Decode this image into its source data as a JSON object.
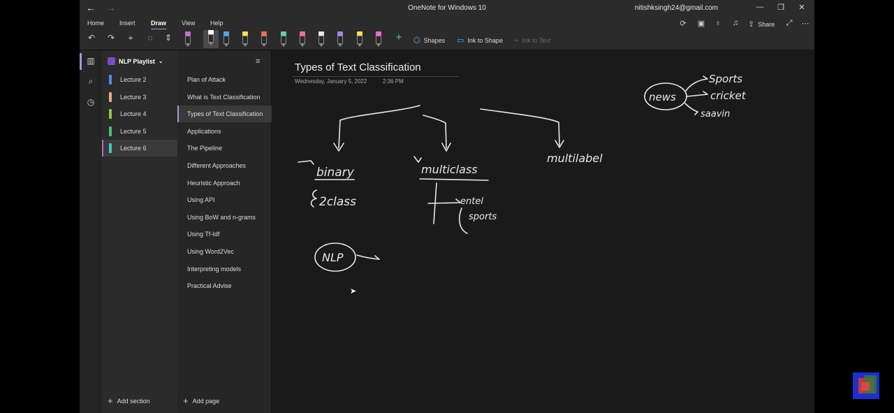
{
  "window": {
    "title": "OneNote for Windows 10",
    "account": "nitishksingh24@gmail.com",
    "back_glyph": "←",
    "forward_glyph": "→",
    "minimize_glyph": "—",
    "restore_glyph": "❐",
    "close_glyph": "✕"
  },
  "menu": {
    "tabs": [
      "Home",
      "Insert",
      "Draw",
      "View",
      "Help"
    ],
    "active": "Draw",
    "share_label": "Share"
  },
  "toolbar": {
    "pens": [
      {
        "color": "#c86bd8",
        "icon": "pen-icon"
      },
      {
        "color": "#ffffff",
        "icon": "pen-icon"
      },
      {
        "color": "#4aa8f0",
        "icon": "pen-icon"
      },
      {
        "color": "#f4e04a",
        "icon": "pen-icon"
      },
      {
        "color": "#f06a50",
        "icon": "pen-icon"
      },
      {
        "color": "#5ad890",
        "icon": "pen-icon"
      },
      {
        "color": "#f06aa0",
        "icon": "pen-icon"
      },
      {
        "color": "#e8e8e8",
        "icon": "pen-icon"
      },
      {
        "color": "#b080f0",
        "icon": "pen-icon"
      },
      {
        "color": "#f4e04a",
        "icon": "pen-icon"
      },
      {
        "color": "#f06ad0",
        "icon": "pen-icon"
      }
    ],
    "shapes_label": "Shapes",
    "ink_to_shape_label": "Ink to Shape",
    "ink_to_text_label": "Ink to Text"
  },
  "notebook": {
    "name": "NLP Playlist",
    "sections": [
      {
        "label": "Lecture 2",
        "color": "#4a8ef0"
      },
      {
        "label": "Lecture 3",
        "color": "#e8b080"
      },
      {
        "label": "Lecture 4",
        "color": "#8ec840"
      },
      {
        "label": "Lecture 5",
        "color": "#40c870"
      },
      {
        "label": "Lecture 6",
        "color": "#40c8c0"
      }
    ],
    "selected_section": "Lecture 6",
    "add_section_label": "Add section"
  },
  "pages": {
    "items": [
      "Plan of Attack",
      "What is Text Classification",
      "Types of Text Classification",
      "Applications",
      "The Pipeline",
      "Different Approaches",
      "Heuristic Approach",
      "Using API",
      "Using BoW and n-grams",
      "Using Tf-Idf",
      "Using Word2Vec",
      "Interpreting models",
      "Practical Advise"
    ],
    "selected_page": "Types of Text Classification",
    "add_page_label": "Add page"
  },
  "page": {
    "title": "Types of Text Classification",
    "date": "Wednesday, January 5, 2022",
    "time": "2:36 PM"
  },
  "ink": {
    "binary": "binary",
    "two_class": "2class",
    "multiclass": "multiclass",
    "entel": "entel",
    "sports_branch": "sports",
    "multilabel": "multilabel",
    "nlp": "NLP",
    "news": "news",
    "sports": "Sports",
    "cricket": "cricket",
    "savan": "saavin"
  }
}
